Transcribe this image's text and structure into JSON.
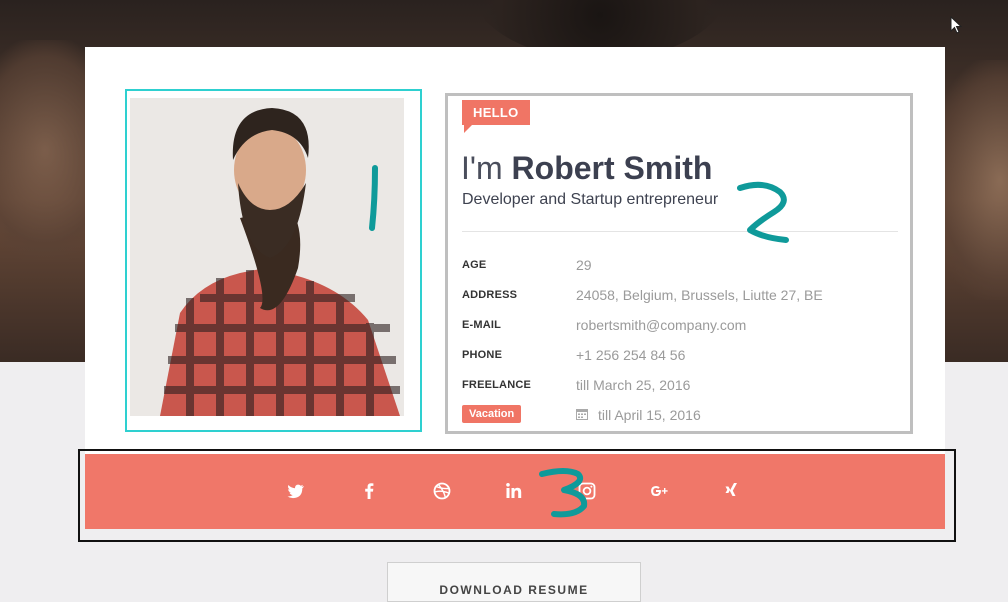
{
  "profile": {
    "badge": "HELLO",
    "greeting": "I'm",
    "name": "Robert Smith",
    "subtitle": "Developer and Startup entrepreneur"
  },
  "details": [
    {
      "label": "AGE",
      "value": "29"
    },
    {
      "label": "ADDRESS",
      "value": "24058, Belgium, Brussels, Liutte 27, BE"
    },
    {
      "label": "E-MAIL",
      "value": "robertsmith@company.com"
    },
    {
      "label": "PHONE",
      "value": "+1 256 254 84 56"
    },
    {
      "label": "FREELANCE",
      "value": "till March 25, 2016"
    }
  ],
  "vacation": {
    "label": "Vacation",
    "value": "till April 15, 2016",
    "icon": "calendar-icon"
  },
  "social": [
    {
      "name": "twitter",
      "icon": "twitter-icon"
    },
    {
      "name": "facebook",
      "icon": "facebook-icon"
    },
    {
      "name": "dribbble",
      "icon": "dribbble-icon"
    },
    {
      "name": "linkedin",
      "icon": "linkedin-icon"
    },
    {
      "name": "instagram",
      "icon": "instagram-icon"
    },
    {
      "name": "google-plus",
      "icon": "google-plus-icon"
    },
    {
      "name": "xing",
      "icon": "xing-icon"
    }
  ],
  "download": {
    "label": "DOWNLOAD RESUME"
  },
  "annotations": {
    "one": "1",
    "two": "2",
    "three": "3"
  },
  "colors": {
    "accent": "#f07765",
    "photo_frame": "#2ed0d0",
    "annotation": "#0f9a9a"
  }
}
